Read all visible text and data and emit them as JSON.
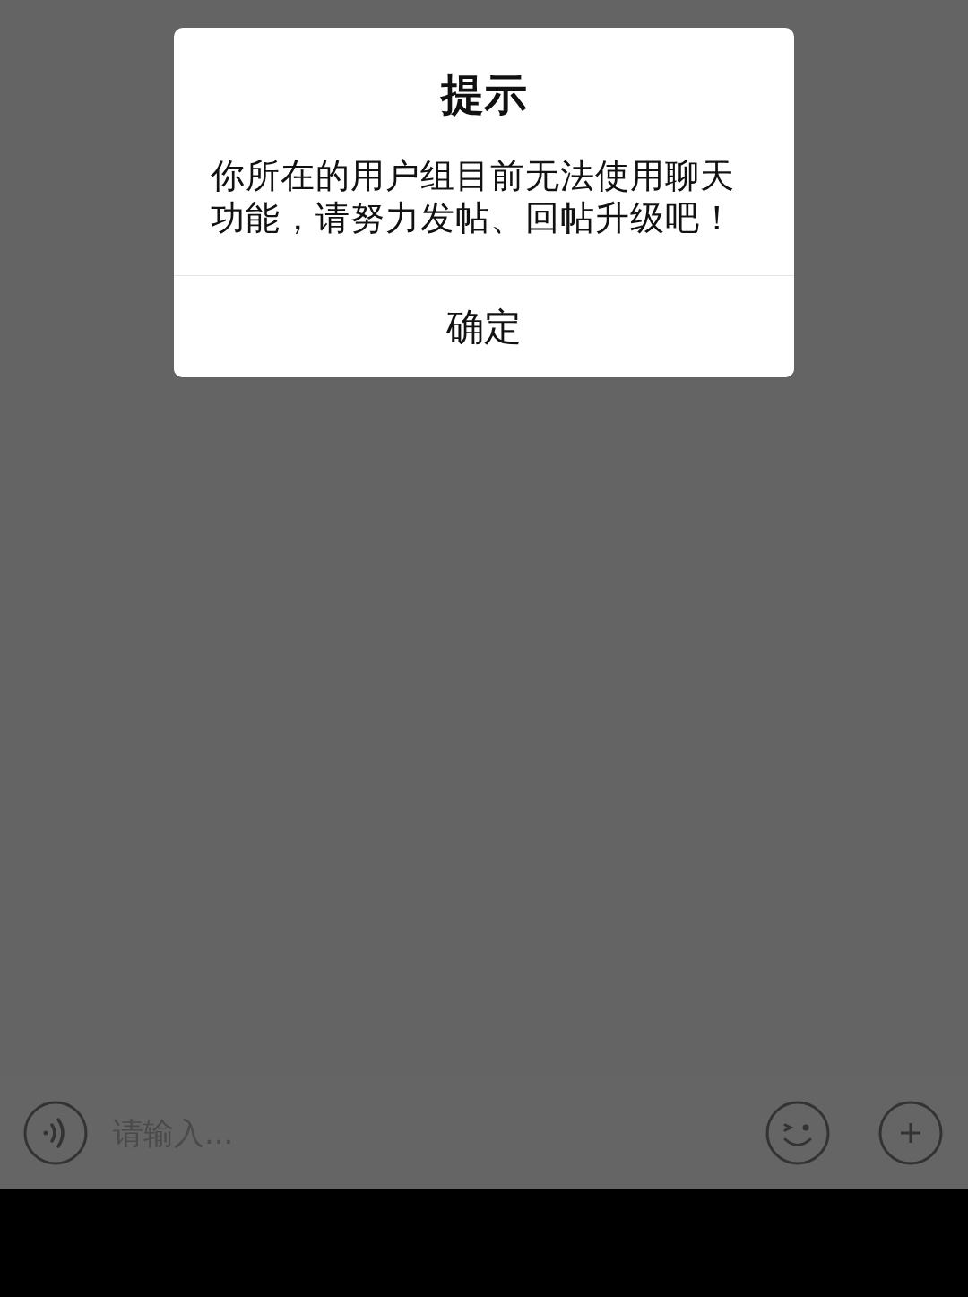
{
  "dialog": {
    "title": "提示",
    "message": "你所在的用户组目前无法使用聊天功能，请努力发帖、回帖升级吧！",
    "buttons": [
      "确定"
    ]
  },
  "input_bar": {
    "placeholder": "请输入..."
  }
}
